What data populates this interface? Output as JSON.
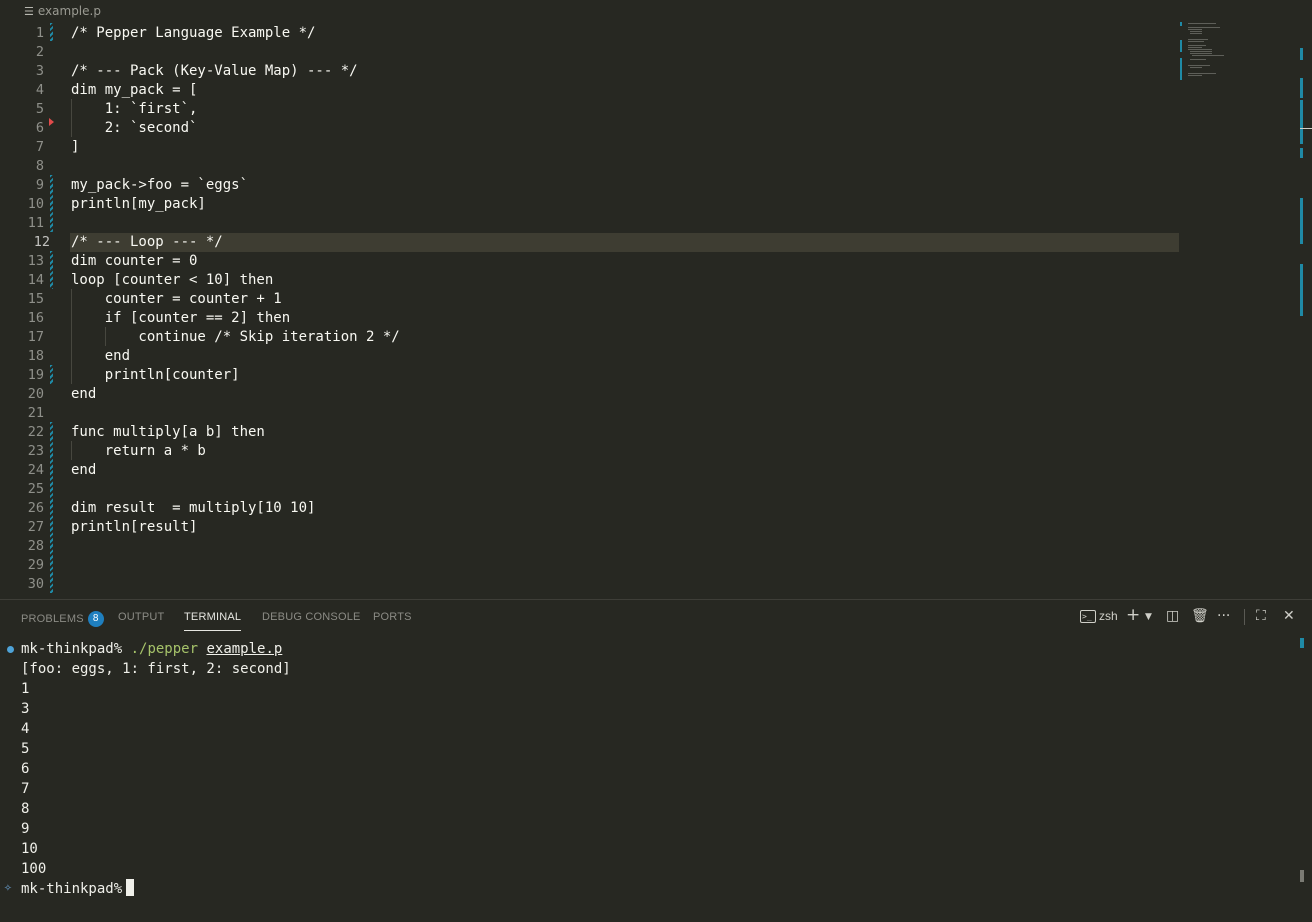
{
  "breadcrumb": {
    "file": "example.p"
  },
  "editor": {
    "current_line": 12,
    "lines": [
      {
        "n": "1",
        "text": "/* Pepper Language Example */"
      },
      {
        "n": "2",
        "text": ""
      },
      {
        "n": "3",
        "text": "/* --- Pack (Key-Value Map) --- */"
      },
      {
        "n": "4",
        "text": "dim my_pack = ["
      },
      {
        "n": "5",
        "text": "    1: `first`,"
      },
      {
        "n": "6",
        "text": "    2: `second`"
      },
      {
        "n": "7",
        "text": "]"
      },
      {
        "n": "8",
        "text": ""
      },
      {
        "n": "9",
        "text": "my_pack->foo = `eggs`"
      },
      {
        "n": "10",
        "text": "println[my_pack]"
      },
      {
        "n": "11",
        "text": ""
      },
      {
        "n": "12",
        "text": "/* --- Loop --- */"
      },
      {
        "n": "13",
        "text": "dim counter = 0"
      },
      {
        "n": "14",
        "text": "loop [counter < 10] then"
      },
      {
        "n": "15",
        "text": "    counter = counter + 1"
      },
      {
        "n": "16",
        "text": "    if [counter == 2] then"
      },
      {
        "n": "17",
        "text": "        continue /* Skip iteration 2 */"
      },
      {
        "n": "18",
        "text": "    end"
      },
      {
        "n": "19",
        "text": "    println[counter]"
      },
      {
        "n": "20",
        "text": "end"
      },
      {
        "n": "21",
        "text": ""
      },
      {
        "n": "22",
        "text": "func multiply[a b] then"
      },
      {
        "n": "23",
        "text": "    return a * b"
      },
      {
        "n": "24",
        "text": "end"
      },
      {
        "n": "25",
        "text": ""
      },
      {
        "n": "26",
        "text": "dim result  = multiply[10 10]"
      },
      {
        "n": "27",
        "text": "println[result]"
      },
      {
        "n": "28",
        "text": ""
      },
      {
        "n": "29",
        "text": ""
      },
      {
        "n": "30",
        "text": ""
      }
    ]
  },
  "panel": {
    "tabs": [
      {
        "label": "PROBLEMS",
        "badge": "8"
      },
      {
        "label": "OUTPUT"
      },
      {
        "label": "TERMINAL",
        "active": true
      },
      {
        "label": "DEBUG CONSOLE"
      },
      {
        "label": "PORTS"
      }
    ],
    "shell": "zsh"
  },
  "terminal": {
    "prompt_host": "mk-thinkpad%",
    "command": "./pepper",
    "command_arg": "example.p",
    "output": [
      "[foo: eggs, 1: first, 2: second]",
      "1",
      "3",
      "4",
      "5",
      "6",
      "7",
      "8",
      "9",
      "10",
      "100"
    ],
    "final_prompt": "mk-thinkpad%"
  },
  "colors": {
    "background": "#272822",
    "accent": "#1f8aa6",
    "badge": "#1f7fbf",
    "prompt_command": "#a6c36a"
  }
}
